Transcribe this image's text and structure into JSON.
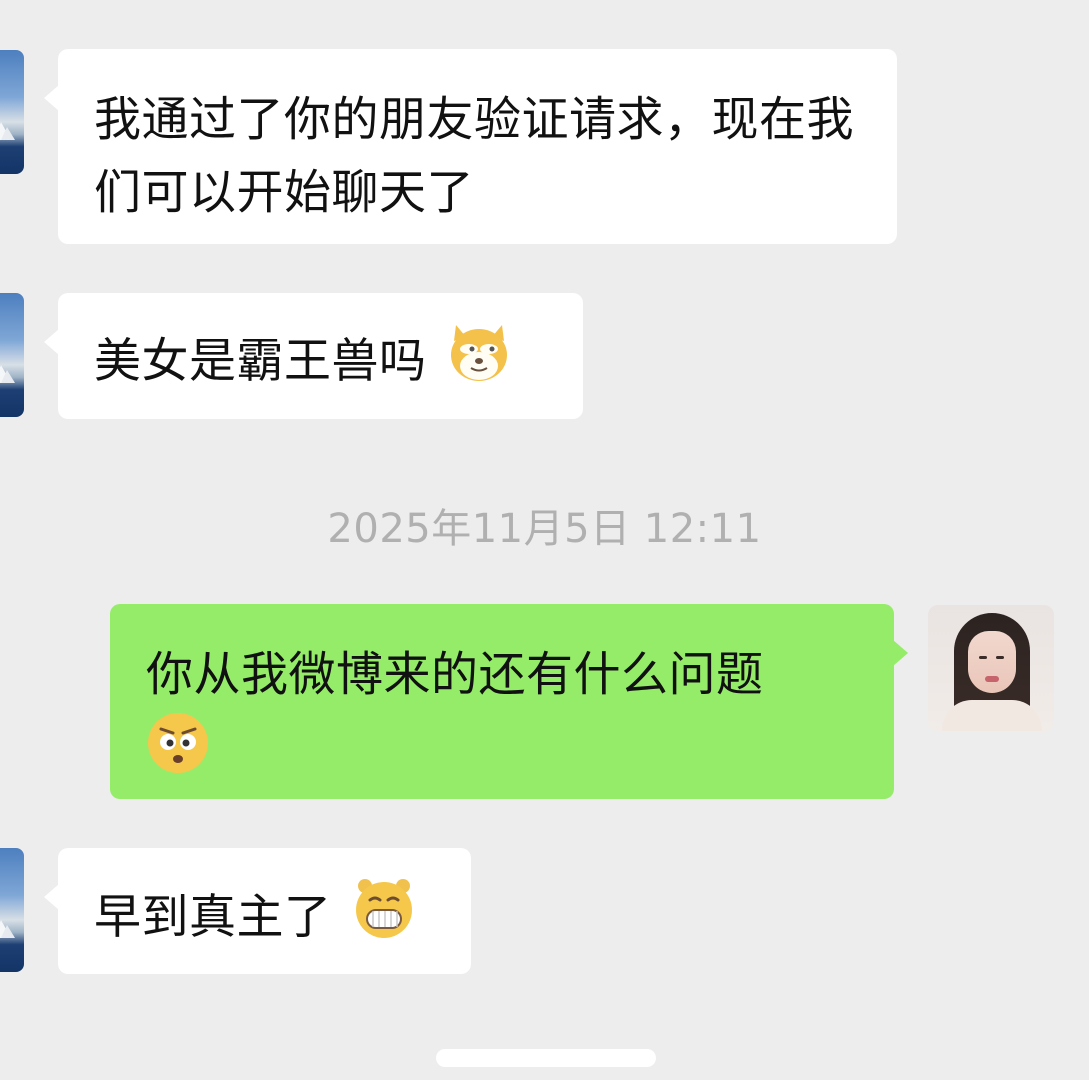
{
  "messages": [
    {
      "sender": "other",
      "text": "我通过了你的朋友验证请求，现在我们可以开始聊天了"
    },
    {
      "sender": "other",
      "text": "美女是霸王兽吗",
      "emoji": "doge-face-icon"
    },
    {
      "sender": "me",
      "text": "你从我微博来的还有什么问题",
      "emoji": "shocked-face-icon"
    },
    {
      "sender": "other",
      "text": "早到真主了",
      "emoji": "grinning-face-icon"
    }
  ],
  "timestamp": "2025年11月5日 12:11",
  "colors": {
    "background": "#ededed",
    "incoming_bubble": "#ffffff",
    "outgoing_bubble": "#95ec69",
    "timestamp_text": "#b0b0b0"
  },
  "icons": {
    "left_avatar": "landmark-avatar",
    "right_avatar": "user-avatar"
  }
}
